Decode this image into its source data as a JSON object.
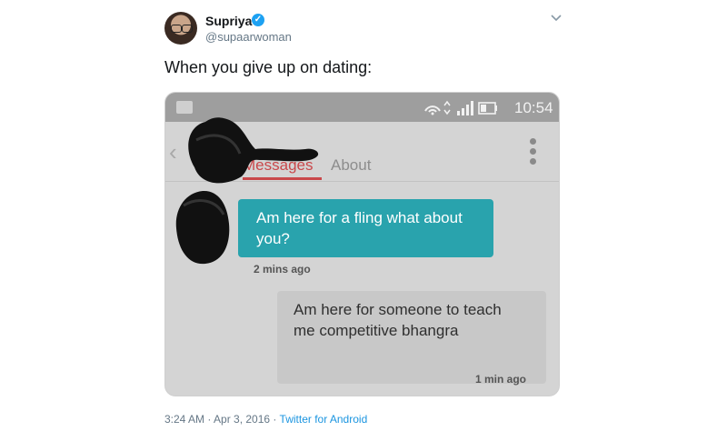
{
  "tweet": {
    "author_name": "Supriya",
    "author_handle": "@supaarwoman",
    "text": "When you give up on dating:",
    "timestamp": "3:24 AM · Apr 3, 2016 · ",
    "source": "Twitter for Android"
  },
  "icons": {
    "verified": "verified-badge-icon",
    "more": "chevron-down-icon"
  },
  "phone": {
    "time": "10:54",
    "tabs": [
      "Messages",
      "About"
    ],
    "active_tab": "Messages",
    "accent_color": "#c9484b",
    "incoming_color": "#29a3ad",
    "messages": [
      {
        "text": "Am here for a fling what about you?",
        "time": "2 mins ago"
      },
      {
        "text": "Am here for someone to teach me competitive bhangra",
        "time": "1 min ago"
      }
    ]
  }
}
